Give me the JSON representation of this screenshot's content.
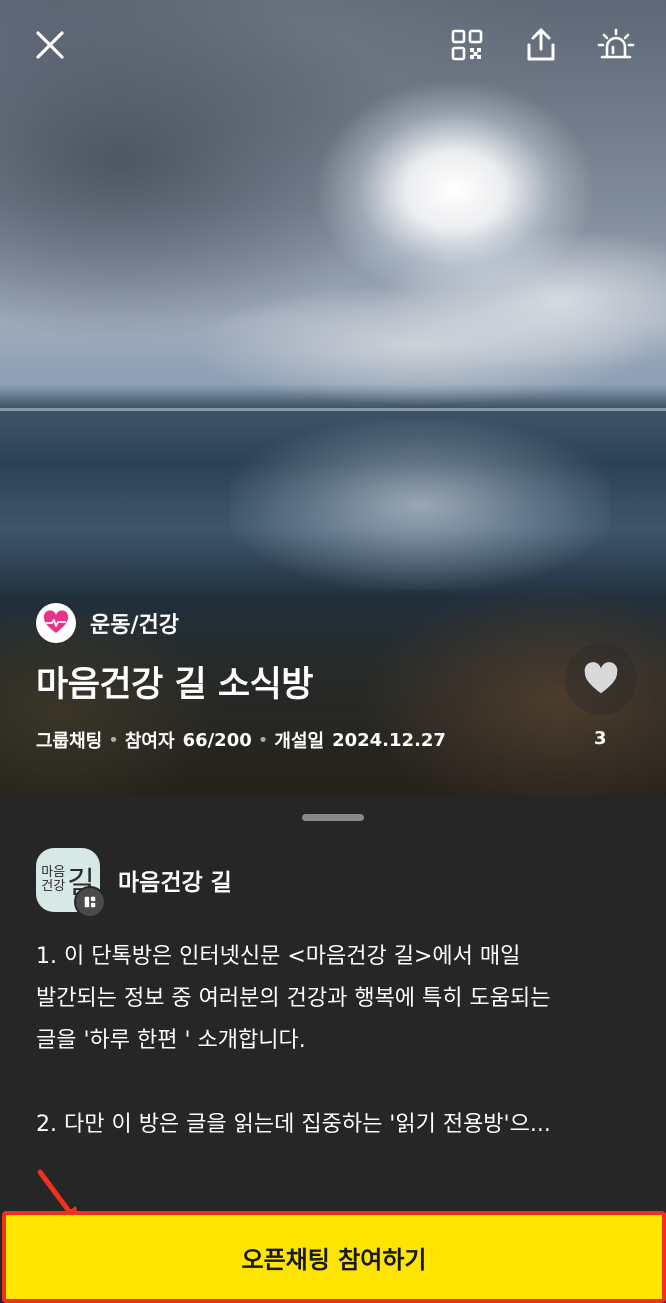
{
  "header": {
    "close_icon": "close-icon",
    "qr_icon": "qr-code-icon",
    "share_icon": "share-icon",
    "report_icon": "siren-icon"
  },
  "room": {
    "category": "운동/건강",
    "title": "마음건강 길 소식방",
    "type_label": "그룹채팅",
    "participants_label": "참여자",
    "participants_value": "66/200",
    "opened_label": "개설일",
    "opened_value": "2024.12.27",
    "like_count": "3"
  },
  "host": {
    "avatar_line1": "마음",
    "avatar_line2": "건강",
    "avatar_big": "길",
    "name": "마음건강 길"
  },
  "description": "1. 이 단톡방은 인터넷신문 <마음건강 길>에서 매일\n발간되는 정보 중 여러분의 건강과 행복에 특히 도움되는\n글을 '하루 한편 ' 소개합니다.\n\n2. 다만 이 방은 글을 읽는데 집중하는 '읽기 전용방'으...",
  "cta": {
    "join_label": "오픈채팅 참여하기"
  },
  "colors": {
    "cta_bg": "#fee500",
    "highlight": "#f0321c",
    "category_icon": "#e8338a"
  }
}
